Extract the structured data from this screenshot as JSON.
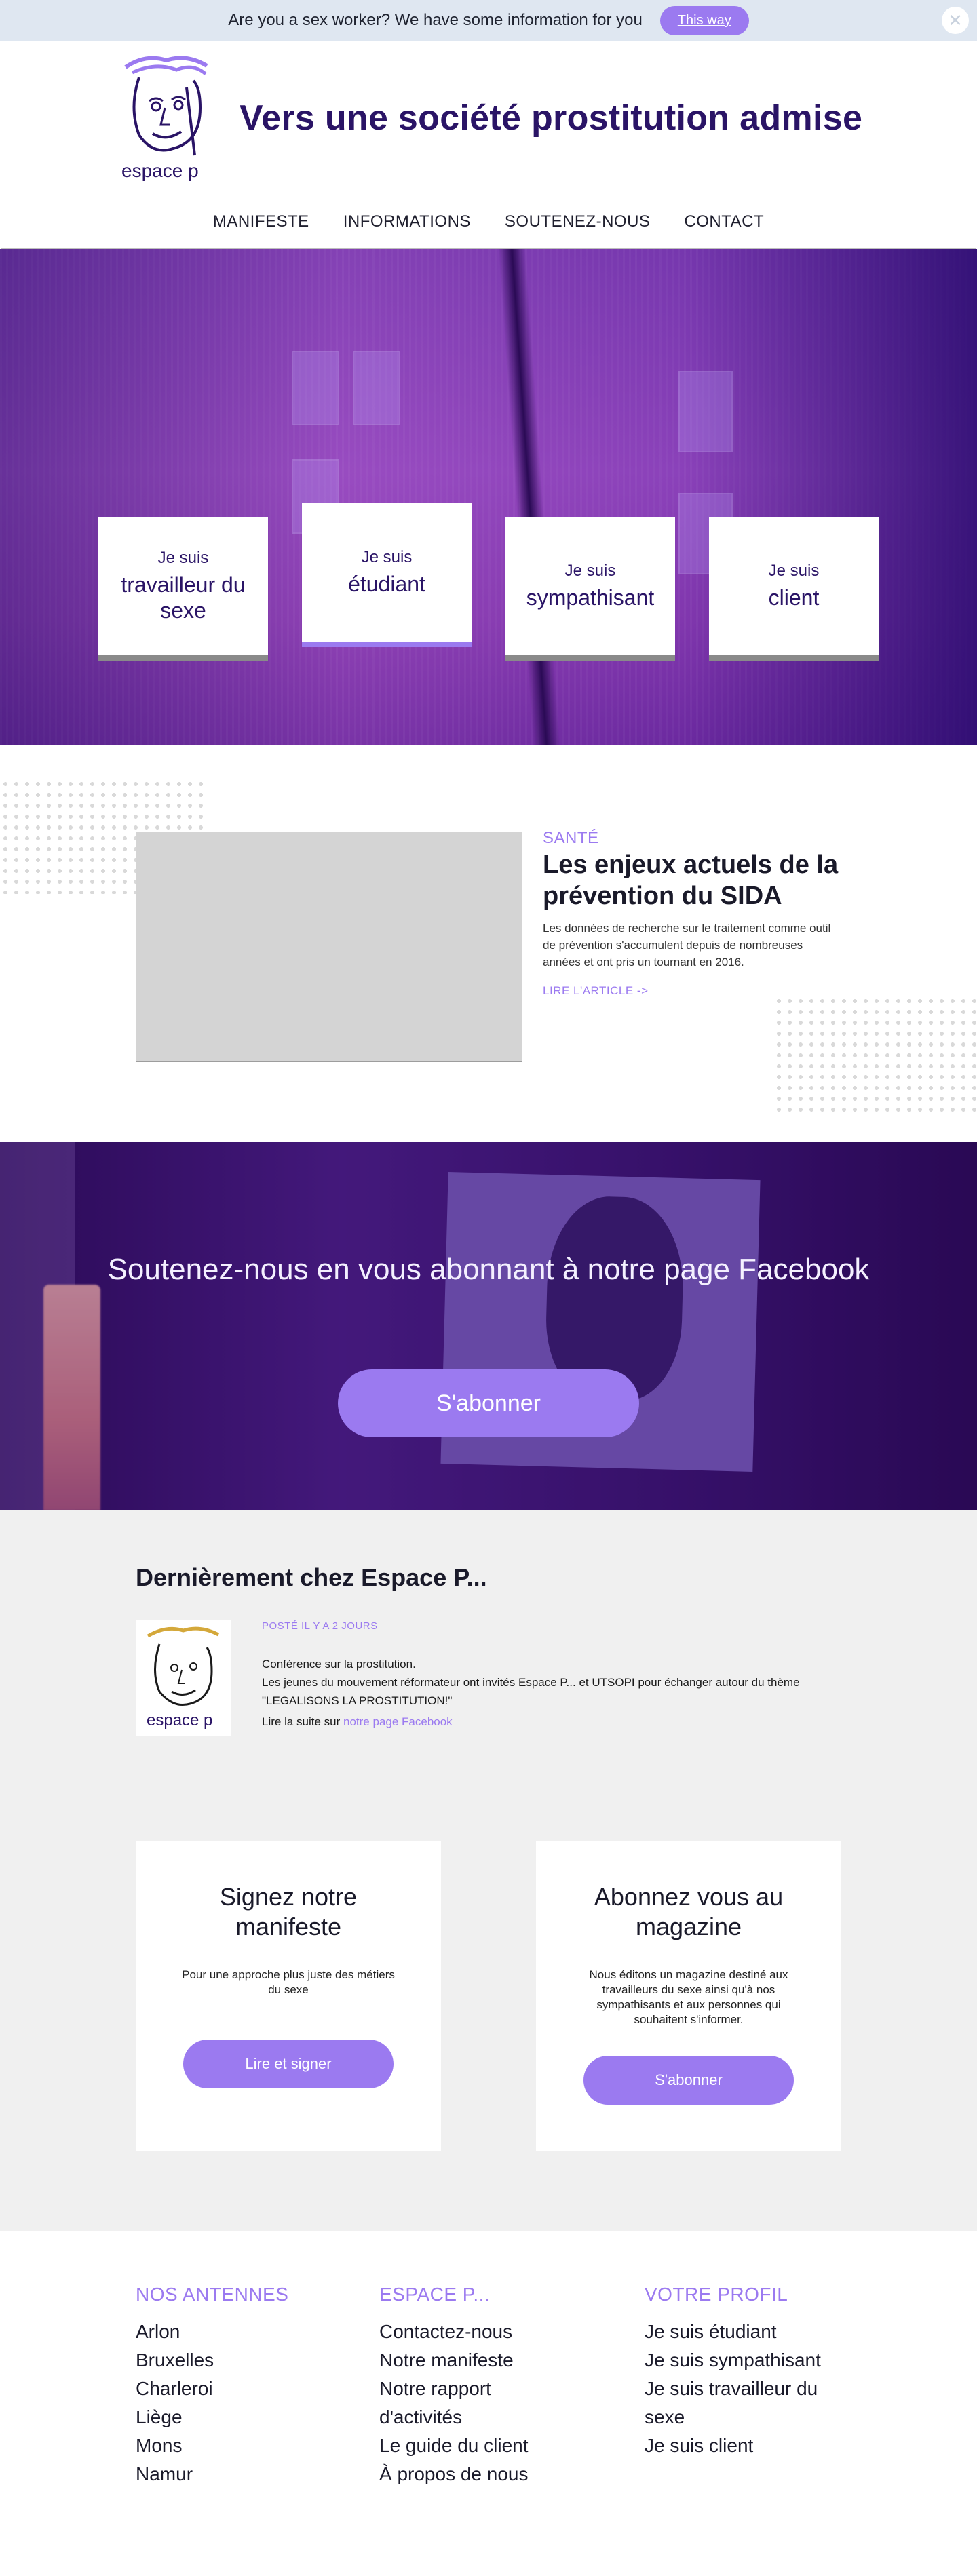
{
  "topbar": {
    "message": "Are you a sex worker? We have some information for you",
    "button": "This way",
    "close_icon": "close-icon"
  },
  "header": {
    "logo_text": "espace p",
    "title": "Vers une société prostitution admise"
  },
  "nav": {
    "items": [
      "MANIFESTE",
      "INFORMATIONS",
      "SOUTENEZ-NOUS",
      "CONTACT"
    ]
  },
  "hero": {
    "cards": [
      {
        "small": "Je suis",
        "big": "travailleur du sexe"
      },
      {
        "small": "Je suis",
        "big": "étudiant"
      },
      {
        "small": "Je suis",
        "big": "sympathisant"
      },
      {
        "small": "Je suis",
        "big": "client"
      }
    ]
  },
  "article": {
    "category": "SANTÉ",
    "title": "Les enjeux actuels de la prévention du SIDA",
    "excerpt": "Les données de recherche sur le traitement comme outil de prévention s'accumulent depuis de nombreuses années et ont pris un tournant en 2016.",
    "link": "LIRE L'ARTICLE ->"
  },
  "facebook": {
    "heading": "Soutenez-nous en vous abonnant à notre page Facebook",
    "button": "S'abonner"
  },
  "latest": {
    "heading": "Dernièrement chez Espace P...",
    "post": {
      "meta": "POSTÉ IL Y A 2 JOURS",
      "line1": "Conférence sur la prostitution.",
      "line2": "Les jeunes du mouvement réformateur ont invités Espace P... et UTSOPI pour échanger autour du thème",
      "line3": "\"LEGALISONS LA PROSTITUTION!\"",
      "read_prefix": "Lire la suite sur",
      "read_link": "notre page Facebook"
    }
  },
  "boxes": {
    "manifesto": {
      "title": "Signez notre manifeste",
      "text": "Pour une approche plus juste des métiers du sexe",
      "button": "Lire et signer"
    },
    "magazine": {
      "title": "Abonnez vous au magazine",
      "text": "Nous éditons un magazine destiné aux travailleurs du sexe ainsi qu'à nos sympathisants et aux personnes qui souhaitent s'informer.",
      "button": "S'abonner"
    }
  },
  "footer": {
    "antennes": {
      "title": "NOS ANTENNES",
      "items": [
        "Arlon",
        "Bruxelles",
        "Charleroi",
        "Liège",
        "Mons",
        "Namur"
      ]
    },
    "espace": {
      "title": "ESPACE P...",
      "items": [
        "Contactez-nous",
        "Notre manifeste",
        "Notre rapport d'activités",
        "Le guide du client",
        "À propos de nous"
      ]
    },
    "profil": {
      "title": "VOTRE PROFIL",
      "items": [
        "Je suis étudiant",
        "Je suis sympathisant",
        "Je suis travailleur du sexe",
        "Je suis client"
      ]
    }
  },
  "colors": {
    "accent": "#9b7af0",
    "brand_dark": "#2a1466"
  }
}
